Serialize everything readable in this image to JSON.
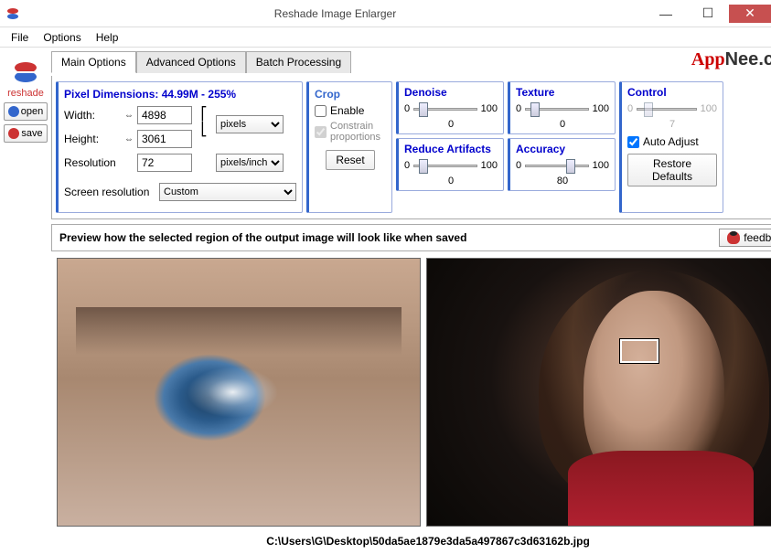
{
  "window": {
    "title": "Reshade Image Enlarger"
  },
  "menu": {
    "file": "File",
    "options": "Options",
    "help": "Help"
  },
  "sidebar": {
    "logo": "reshade",
    "open": "open",
    "save": "save"
  },
  "tabs": {
    "main": "Main Options",
    "advanced": "Advanced Options",
    "batch": "Batch Processing"
  },
  "pixdim": {
    "header": "Pixel Dimensions:  44.99M - 255%",
    "width_label": "Width:",
    "width_value": "4898",
    "height_label": "Height:",
    "height_value": "3061",
    "res_label": "Resolution",
    "res_value": "72",
    "unit_px": "pixels",
    "unit_ppi": "pixels/inch",
    "screen_label": "Screen resolution",
    "screen_value": "Custom"
  },
  "crop": {
    "title": "Crop",
    "enable": "Enable",
    "constrain": "Constrain proportions",
    "reset": "Reset"
  },
  "sliders": {
    "denoise": {
      "title": "Denoise",
      "min": "0",
      "max": "100",
      "value": "0",
      "pos": 8
    },
    "reduce": {
      "title": "Reduce Artifacts",
      "min": "0",
      "max": "100",
      "value": "0",
      "pos": 8
    },
    "texture": {
      "title": "Texture",
      "min": "0",
      "max": "100",
      "value": "0",
      "pos": 8
    },
    "accuracy": {
      "title": "Accuracy",
      "min": "0",
      "max": "100",
      "value": "80",
      "pos": 65
    }
  },
  "control": {
    "title": "Control",
    "min": "0",
    "max": "100",
    "value": "7",
    "pos": 12,
    "auto": "Auto Adjust",
    "restore": "Restore Defaults"
  },
  "preview": {
    "text": "Preview how the selected region of the output image will look like when saved",
    "feedback": "feedback"
  },
  "status": {
    "path": "C:\\Users\\G\\Desktop\\50da5ae1879e3da5a497867c3d63162b.jpg"
  },
  "watermark": {
    "a": "App",
    "b": "Nee",
    "c": ".com"
  }
}
